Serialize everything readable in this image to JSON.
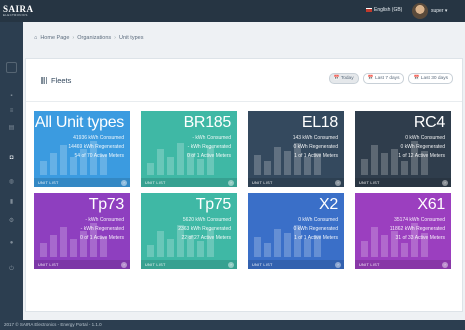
{
  "app": {
    "brand": "SAIRA",
    "brand_sub": "ELECTRONICS",
    "language": "English (GB)",
    "user": "super"
  },
  "breadcrumb": [
    "Home Page",
    "Organizations",
    "Unit types"
  ],
  "panel": {
    "title": "Fleets",
    "filters": [
      {
        "label": "Today",
        "active": true
      },
      {
        "label": "Last 7 days",
        "active": false
      },
      {
        "label": "Last 30 days",
        "active": false
      }
    ]
  },
  "cards": [
    {
      "name": "All Unit types",
      "consumed": "41936 kWh Consumed",
      "regenerated": "14469 kWh Regenerated",
      "meters": "54 of 70 Active Meters",
      "footer": "UNIT LIST",
      "color": "#3b9be0"
    },
    {
      "name": "BR185",
      "consumed": "- kWh Consumed",
      "regenerated": "- kWh Regenerated",
      "meters": "0 of 1 Active Meters",
      "footer": "UNIT LIST",
      "color": "#3fb8a5"
    },
    {
      "name": "EL18",
      "consumed": "143 kWh Consumed",
      "regenerated": "0 kWh Regenerated",
      "meters": "1 of 1 Active Meters",
      "footer": "UNIT LIST",
      "color": "#34495e"
    },
    {
      "name": "RC4",
      "consumed": "0 kWh Consumed",
      "regenerated": "0 kWh Regenerated",
      "meters": "1 of 12 Active Meters",
      "footer": "UNIT LIST",
      "color": "#2f3d4c"
    },
    {
      "name": "Tp73",
      "consumed": "- kWh Consumed",
      "regenerated": "- kWh Regenerated",
      "meters": "0 of 1 Active Meters",
      "footer": "UNIT LIST",
      "color": "#8e3fbf"
    },
    {
      "name": "Tp75",
      "consumed": "5620 kWh Consumed",
      "regenerated": "2363 kWh Regenerated",
      "meters": "22 of 27 Active Meters",
      "footer": "UNIT LIST",
      "color": "#3fb8a5"
    },
    {
      "name": "X2",
      "consumed": "0 kWh Consumed",
      "regenerated": "0 kWh Regenerated",
      "meters": "1 of 1 Active Meters",
      "footer": "UNIT LIST",
      "color": "#3a6fc8"
    },
    {
      "name": "X61",
      "consumed": "35174 kWh Consumed",
      "regenerated": "11862 kWh Regenerated",
      "meters": "31 of 33 Active Meters",
      "footer": "UNIT LIST",
      "color": "#9b3fbf"
    }
  ],
  "footer": {
    "text": "2017 © SAIRA Electronics - Energy Portal - 1.1.0"
  },
  "icons": {
    "sidebar": [
      "menu-icon",
      "home-icon",
      "list-icon",
      "document-icon",
      "train-icon",
      "globe-icon",
      "chart-icon",
      "settings-icon",
      "user-icon",
      "logout-icon"
    ]
  }
}
